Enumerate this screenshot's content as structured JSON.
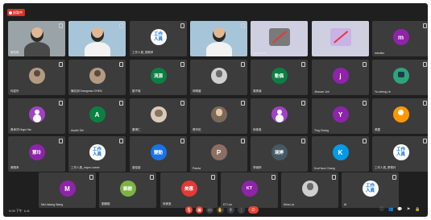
{
  "recording": {
    "label": "錄製中"
  },
  "tiles": [
    {
      "name": "陳柏毅",
      "type": "video"
    },
    {
      "name": "",
      "type": "video"
    },
    {
      "name": "工作人員_簡莉婷",
      "type": "org"
    },
    {
      "name": "",
      "type": "video"
    },
    {
      "name": "lightthrone",
      "type": "share"
    },
    {
      "name": "",
      "type": "share"
    },
    {
      "name": "msmiko",
      "type": "letter",
      "initial": "m",
      "color": "#8e24aa"
    },
    {
      "name": "何姿伶",
      "type": "person"
    },
    {
      "name": "陳兆欣Changmao CHEN",
      "type": "person"
    },
    {
      "name": "劉子瑄",
      "type": "letter",
      "initial": "流源",
      "color": "#0b8043"
    },
    {
      "name": "林曉薇",
      "type": "mono"
    },
    {
      "name": "周彥誠",
      "type": "letter",
      "initial": "動偶",
      "color": "#0b8043"
    },
    {
      "name": "Jinxuan Joh",
      "type": "letter",
      "initial": "j",
      "color": "#8e24aa"
    },
    {
      "name": "Yu-sheng Lin",
      "type": "robot"
    },
    {
      "name": "黃承洋Yings Hsu",
      "type": "purple"
    },
    {
      "name": "Austin Teh",
      "type": "letter",
      "initial": "A",
      "color": "#0b8043"
    },
    {
      "name": "蕭博仁",
      "type": "dog"
    },
    {
      "name": "蔡宗佑",
      "type": "photo"
    },
    {
      "name": "林美惠",
      "type": "purple"
    },
    {
      "name": "Ting Chang",
      "type": "letter",
      "initial": "Y",
      "color": "#8e24aa"
    },
    {
      "name": "黃露",
      "type": "orange"
    },
    {
      "name": "黃曉禾",
      "type": "letter",
      "initial": "慧玲",
      "color": "#8e24aa"
    },
    {
      "name": "工作人員_miyou coeze",
      "type": "org"
    },
    {
      "name": "曾俊豪",
      "type": "letter",
      "initial": "變動",
      "color": "#1a73e8"
    },
    {
      "name": "Panda",
      "type": "letter",
      "initial": "P",
      "color": "#8d6e63"
    },
    {
      "name": "李婉婷",
      "type": "letter",
      "initial": "琬婷",
      "color": "#455a64"
    },
    {
      "name": "KuoHsun Chang",
      "type": "letter",
      "initial": "K",
      "color": "#039be5"
    },
    {
      "name": "工作人員_蔡佩玲",
      "type": "org"
    },
    {
      "name": "Mei-hsiang Wang",
      "type": "letter",
      "initial": "M",
      "color": "#8e24aa"
    },
    {
      "name": "劉錦樹",
      "type": "letter",
      "initial": "錦樹",
      "color": "#7cb342"
    },
    {
      "name": "林美惠",
      "type": "letter",
      "initial": "美惠",
      "color": "#e53935"
    },
    {
      "name": "KT Lim",
      "type": "letter",
      "initial": "KT",
      "color": "#8e24aa"
    },
    {
      "name": "Mina Lai",
      "type": "mono"
    },
    {
      "name": "ttt",
      "type": "org"
    }
  ],
  "bottom": {
    "time": "9:09 下午",
    "code": "k-4l",
    "end": "⏻"
  }
}
